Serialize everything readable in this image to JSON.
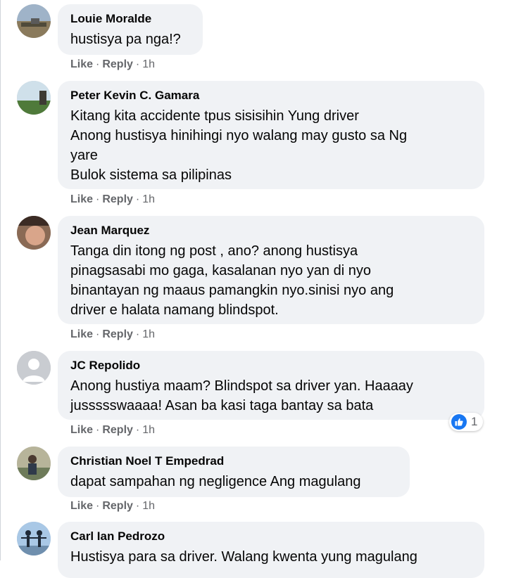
{
  "colors": {
    "bubble": "#f0f2f5",
    "meta_text": "#65676b",
    "like_blue": "#1877f2"
  },
  "actions": {
    "like": "Like",
    "reply": "Reply",
    "dot": "·"
  },
  "comments": [
    {
      "author": "Louie Moralde",
      "lines": [
        "hustisya pa nga!?"
      ],
      "time": "1h",
      "avatar_icon": "landscape-photo-avatar"
    },
    {
      "author": "Peter Kevin C. Gamara",
      "lines": [
        "Kitang kita accidente tpus sisisihin Yung driver",
        "Anong hustisya hinihingi nyo walang may gusto sa Ng",
        "yare",
        "Bulok sistema sa pilipinas"
      ],
      "time": "1h",
      "avatar_icon": "outdoor-photo-avatar"
    },
    {
      "author": "Jean Marquez",
      "lines": [
        "Tanga din itong ng post , ano? anong hustisya",
        "pinagsasabi mo gaga, kasalanan nyo yan di nyo",
        "binantayan ng maaus pamangkin nyo.sinisi nyo ang",
        "driver e halata namang blindspot."
      ],
      "time": "1h",
      "avatar_icon": "selfie-photo-avatar"
    },
    {
      "author": "JC Repolido",
      "lines": [
        "Anong hustiya maam? Blindspot sa driver yan. Haaaay",
        "jussssswaaaa! Asan ba kasi taga bantay sa bata"
      ],
      "time": "1h",
      "avatar_icon": "default-user-avatar",
      "reaction": {
        "icon": "like-reaction-icon",
        "count": "1"
      }
    },
    {
      "author": "Christian Noel T Empedrad",
      "lines": [
        "dapat sampahan ng negligence Ang magulang"
      ],
      "time": "1h",
      "avatar_icon": "portrait-photo-avatar"
    },
    {
      "author": "Carl Ian Pedrozo",
      "lines": [
        "Hustisya para sa driver. Walang kwenta yung magulang"
      ],
      "time": "",
      "avatar_icon": "couple-photo-avatar"
    }
  ]
}
